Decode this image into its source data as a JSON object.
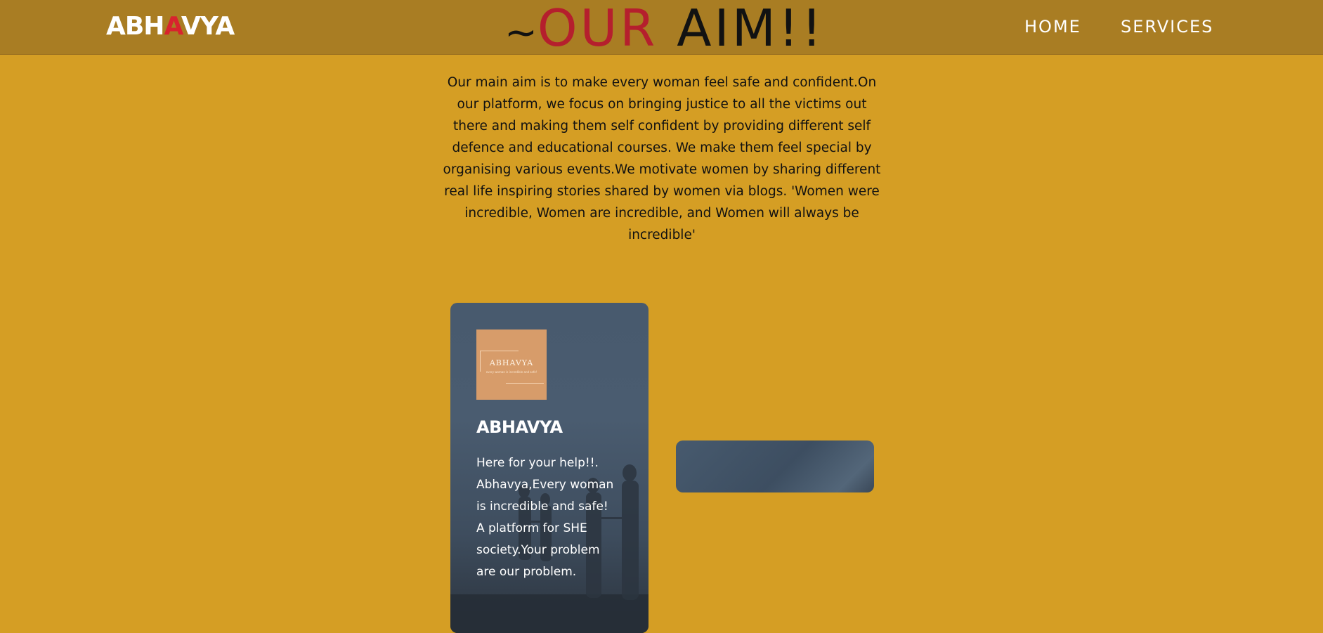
{
  "header": {
    "logo_part1": "ABH",
    "logo_accent": "A",
    "logo_part2": "VYA",
    "title_tilde": "~",
    "title_red": "OUR",
    "title_dark": "AIM!!",
    "nav": [
      {
        "label": "HOME"
      },
      {
        "label": "SERVICES"
      }
    ]
  },
  "aim": {
    "text": "Our main aim is to make every woman feel safe and confident.On our platform, we focus on bringing justice to all the victims out there and making them self confident by providing different self defence and educational courses. We make them feel special by organising various events.We motivate women by sharing different real life inspiring stories shared by women via blogs. 'Women were incredible, Women are incredible, and Women will always be incredible'"
  },
  "card": {
    "logo_image_text": "ABHAVYA",
    "logo_image_subtext": "every woman is incredible and safe!",
    "title": "ABHAVYA",
    "description": "Here for your help!!. Abhavya,Every woman is incredible and safe! A platform for SHE society.Your problem are our problem."
  },
  "colors": {
    "page_background": "#d59e24",
    "navbar_background": "#a97d23",
    "accent_red": "#d8232e",
    "title_red": "#b51f2d",
    "card_background": "#485a6e"
  }
}
